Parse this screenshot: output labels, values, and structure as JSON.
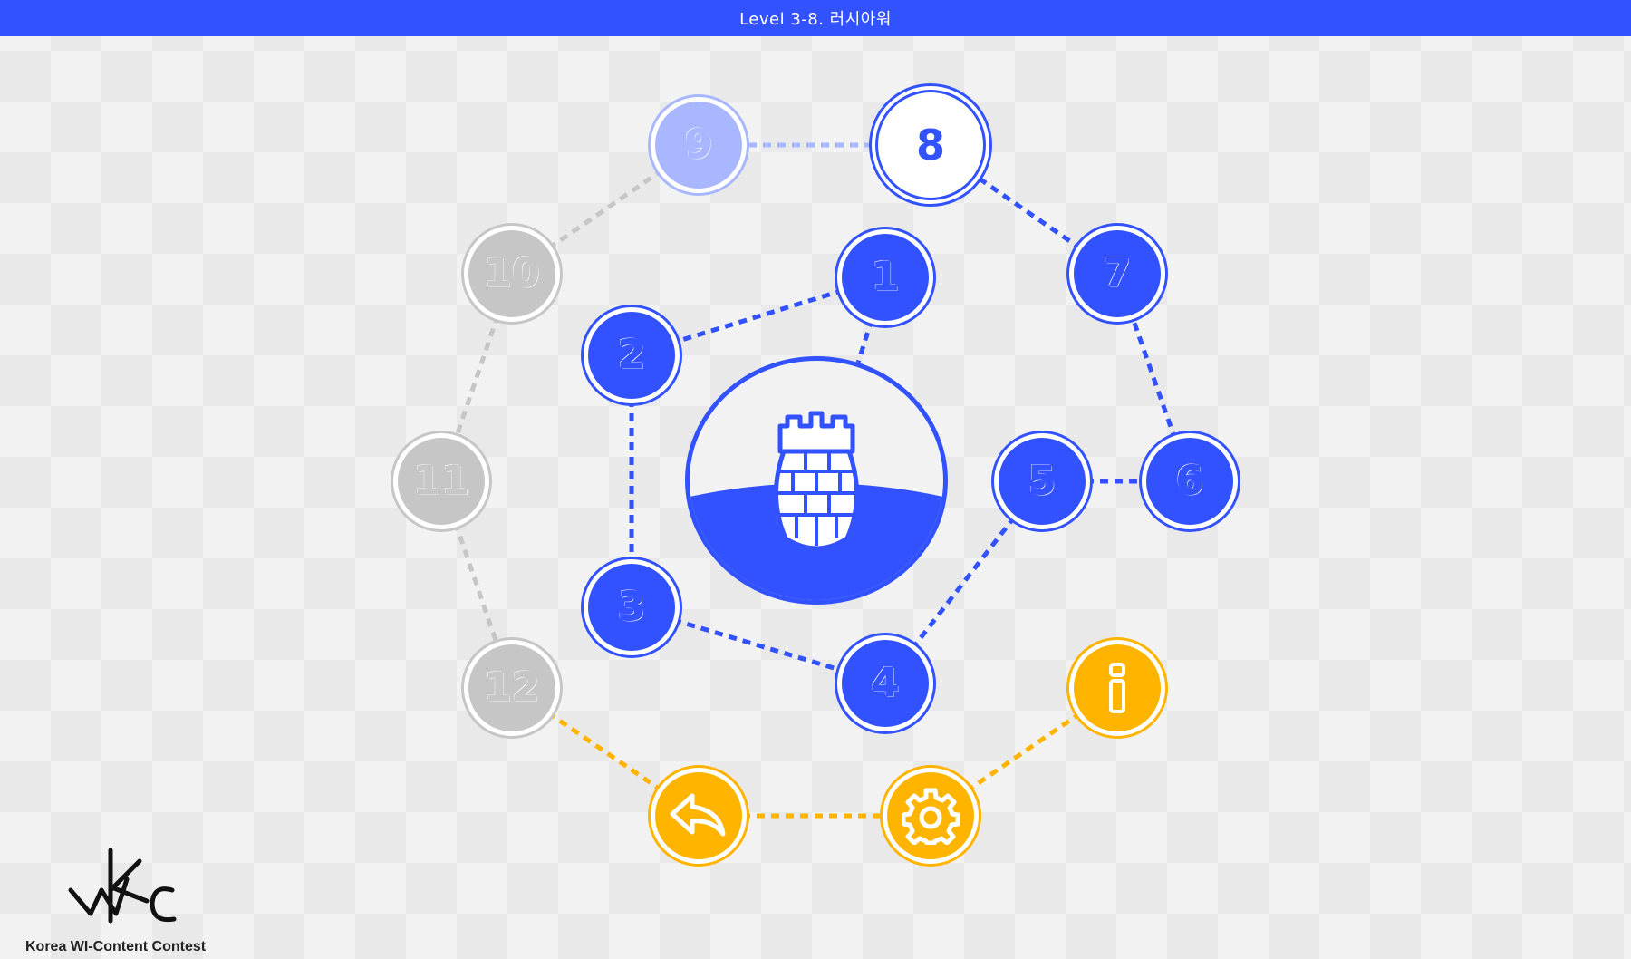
{
  "header": {
    "title": "Level 3-8. 러시아워"
  },
  "levels": [
    {
      "label": "1",
      "state": "completed"
    },
    {
      "label": "2",
      "state": "completed"
    },
    {
      "label": "3",
      "state": "completed"
    },
    {
      "label": "4",
      "state": "completed"
    },
    {
      "label": "5",
      "state": "completed"
    },
    {
      "label": "6",
      "state": "completed"
    },
    {
      "label": "7",
      "state": "completed"
    },
    {
      "label": "8",
      "state": "current"
    },
    {
      "label": "9",
      "state": "next"
    },
    {
      "label": "10",
      "state": "locked"
    },
    {
      "label": "11",
      "state": "locked"
    },
    {
      "label": "12",
      "state": "locked"
    }
  ],
  "controls": {
    "back_icon": "back-arrow-icon",
    "settings_icon": "gear-icon",
    "info_icon": "info-icon"
  },
  "colors": {
    "primary": "#3352ff",
    "faded": "#a8b7ff",
    "locked": "#c6c6c6",
    "control": "#ffb400"
  },
  "footer": {
    "logo_text": "Korea WI-Content Contest"
  }
}
